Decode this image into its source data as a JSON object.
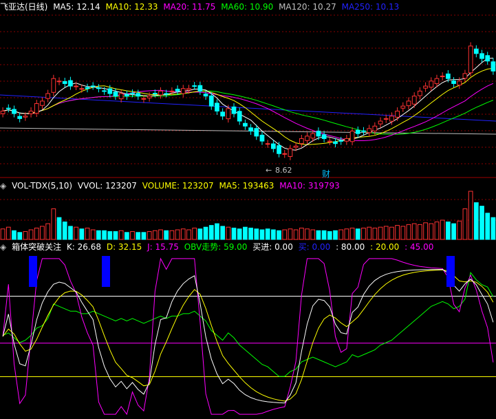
{
  "main_header": {
    "title": "飞亚达(日线)",
    "ma5": "MA5: 12.14",
    "ma10": "MA10: 12.33",
    "ma20": "MA20: 11.75",
    "ma60": "MA60: 10.90",
    "ma120": "MA120: 10.27",
    "ma250": "MA250: 10.13"
  },
  "vol_header": {
    "title": "VOL-TDX(5,10)",
    "vvol": "VVOL: 123207",
    "volume": "VOLUME: 123207",
    "ma5": "MA5: 193463",
    "ma10": "MA10: 319793"
  },
  "ind_header": {
    "title": "箱体突破关注",
    "k": "K: 26.68",
    "d": "D: 32.15",
    "j": "J: 15.75",
    "obv": "OBV走势: 59.00",
    "buy_in": "买进: 0.00",
    "buy": "买: 0.00",
    "v80": ": 80.00",
    "v20": ": 20.00",
    "v45": ": 45.00"
  },
  "annotations": {
    "low_price": "8.62",
    "fin_marker": "财"
  },
  "colors": {
    "up": "#ff3232",
    "down": "#00ffff",
    "ma5": "#ffffff",
    "ma10": "#ffff00",
    "ma20": "#ff00ff",
    "ma60": "#00ff00",
    "ma120": "#c0c0c0",
    "ma250": "#2222ff",
    "grid": "#8b0000",
    "signal": "#0000ff"
  },
  "chart_data": {
    "type": "candlestick",
    "title": "飞亚达(日线)",
    "ylim": [
      8.0,
      14.6
    ],
    "low_marker": 8.62,
    "closes": [
      10.6,
      10.7,
      10.5,
      10.3,
      10.4,
      10.6,
      10.9,
      11.0,
      11.3,
      11.9,
      11.8,
      11.7,
      11.6,
      11.6,
      11.5,
      11.5,
      11.6,
      11.5,
      11.4,
      11.3,
      11.2,
      11.3,
      11.2,
      11.3,
      11.2,
      11.1,
      11.2,
      11.3,
      11.4,
      11.3,
      11.4,
      11.4,
      11.5,
      11.5,
      11.6,
      11.4,
      11.2,
      10.8,
      10.6,
      10.4,
      10.7,
      10.5,
      10.2,
      10.0,
      9.8,
      9.6,
      9.4,
      9.3,
      9.1,
      8.9,
      8.9,
      9.1,
      9.2,
      9.5,
      9.6,
      9.7,
      9.6,
      9.5,
      9.4,
      9.3,
      9.4,
      9.5,
      9.8,
      9.7,
      9.8,
      9.9,
      10.0,
      10.2,
      10.3,
      10.4,
      10.6,
      10.8,
      11.0,
      11.2,
      11.4,
      11.6,
      11.8,
      11.9,
      12.0,
      11.9,
      11.7,
      11.8,
      12.1,
      13.2,
      12.9,
      12.7,
      12.6,
      12.2
    ],
    "volume": [
      0.12,
      0.14,
      0.1,
      0.08,
      0.09,
      0.11,
      0.13,
      0.15,
      0.18,
      0.35,
      0.25,
      0.2,
      0.15,
      0.14,
      0.12,
      0.13,
      0.11,
      0.1,
      0.1,
      0.09,
      0.09,
      0.1,
      0.08,
      0.09,
      0.08,
      0.08,
      0.09,
      0.1,
      0.11,
      0.1,
      0.1,
      0.11,
      0.12,
      0.11,
      0.13,
      0.12,
      0.14,
      0.16,
      0.18,
      0.15,
      0.14,
      0.13,
      0.12,
      0.14,
      0.13,
      0.12,
      0.11,
      0.12,
      0.11,
      0.1,
      0.11,
      0.12,
      0.11,
      0.13,
      0.12,
      0.11,
      0.1,
      0.1,
      0.09,
      0.1,
      0.11,
      0.12,
      0.13,
      0.12,
      0.13,
      0.14,
      0.13,
      0.14,
      0.15,
      0.14,
      0.16,
      0.15,
      0.17,
      0.18,
      0.17,
      0.19,
      0.18,
      0.2,
      0.22,
      0.2,
      0.18,
      0.21,
      0.35,
      0.55,
      0.42,
      0.38,
      0.3,
      0.25
    ],
    "indicator_levels": [
      80,
      45,
      20
    ],
    "signal_bars": [
      48,
      154,
      655
    ]
  }
}
